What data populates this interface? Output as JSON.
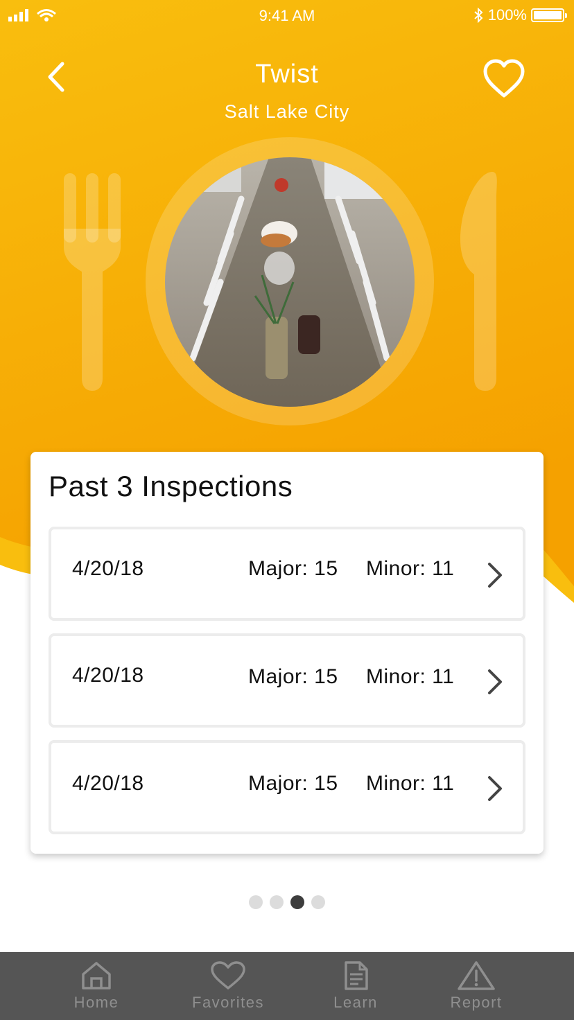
{
  "status_bar": {
    "time": "9:41 AM",
    "battery": "100%",
    "battery_level": 1.0
  },
  "header": {
    "title": "Twist",
    "subtitle": "Salt Lake City",
    "back_icon": "chevron-left-icon",
    "favorite_icon": "heart-icon"
  },
  "colors": {
    "accent": "#F7A70C",
    "accent_light": "#F9BF0F",
    "tab_bar": "#555555",
    "tab_inactive": "#8F8F8F"
  },
  "inspections": {
    "title": "Past 3 Inspections",
    "rows": [
      {
        "date": "4/20/18",
        "major": "Major: 15",
        "minor": "Minor: 11"
      },
      {
        "date": "4/20/18",
        "major": "Major: 15",
        "minor": "Minor: 11"
      },
      {
        "date": "4/20/18",
        "major": "Major: 15",
        "minor": "Minor: 11"
      }
    ]
  },
  "pager": {
    "count": 4,
    "active_index": 2
  },
  "tabs": [
    {
      "label": "Home",
      "icon": "home-icon"
    },
    {
      "label": "Favorites",
      "icon": "heart-icon"
    },
    {
      "label": "Learn",
      "icon": "document-icon"
    },
    {
      "label": "Report",
      "icon": "warning-icon"
    }
  ]
}
